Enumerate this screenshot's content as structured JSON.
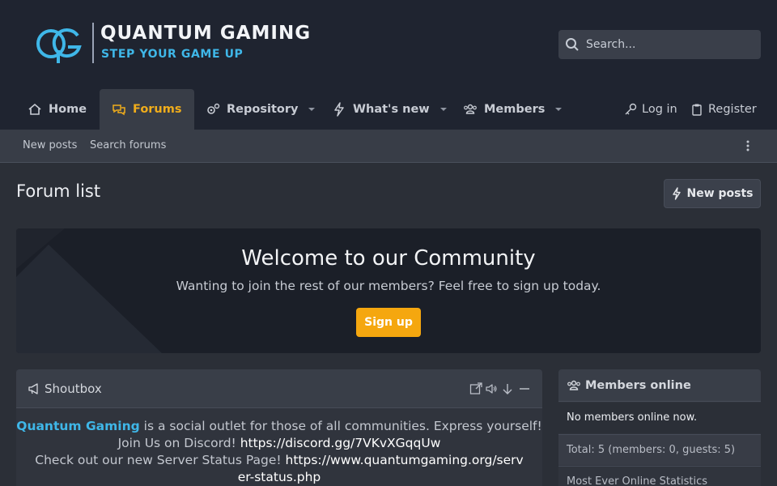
{
  "header": {
    "logo_title": "QUANTUM GAMING",
    "logo_tagline": "STEP YOUR GAME UP",
    "search_placeholder": "Search..."
  },
  "nav": {
    "tabs": [
      {
        "label": "Home",
        "icon": "home-icon",
        "active": false
      },
      {
        "label": "Forums",
        "icon": "comments-icon",
        "active": true
      },
      {
        "label": "Repository",
        "icon": "cogs-icon",
        "active": false,
        "dropdown": true
      },
      {
        "label": "What's new",
        "icon": "bolt-icon",
        "active": false,
        "dropdown": true
      },
      {
        "label": "Members",
        "icon": "users-icon",
        "active": false,
        "dropdown": true
      }
    ],
    "login": "Log in",
    "register": "Register"
  },
  "subnav": {
    "items": [
      "New posts",
      "Search forums"
    ]
  },
  "page": {
    "title": "Forum list",
    "new_posts_button": "New posts"
  },
  "welcome": {
    "title": "Welcome to our Community",
    "text": "Wanting to join the rest of our members? Feel free to sign up today.",
    "signup_button": "Sign up"
  },
  "shoutbox": {
    "title": "Shoutbox",
    "brand": "Quantum Gaming",
    "line1_rest": " is a social outlet for those of all communities. Express yourself!",
    "line2_prefix": "Join Us on Discord! ",
    "discord_link": "https://discord.gg/7VKvXGqqUw",
    "line3_prefix": "Check out our new Server Status Page! ",
    "status_link": "https://www.quantumgaming.org/server-status.php"
  },
  "members_online": {
    "title": "Members online",
    "none_text": "No members online now.",
    "total_text": "Total: 5 (members: 0, guests: 5)",
    "stats_text": "Most Ever Online Statistics"
  },
  "colors": {
    "accent": "#f0ad1b",
    "brand_blue": "#3fb7e8",
    "header_bg": "#1f2430",
    "body_bg": "#2b2f37"
  }
}
